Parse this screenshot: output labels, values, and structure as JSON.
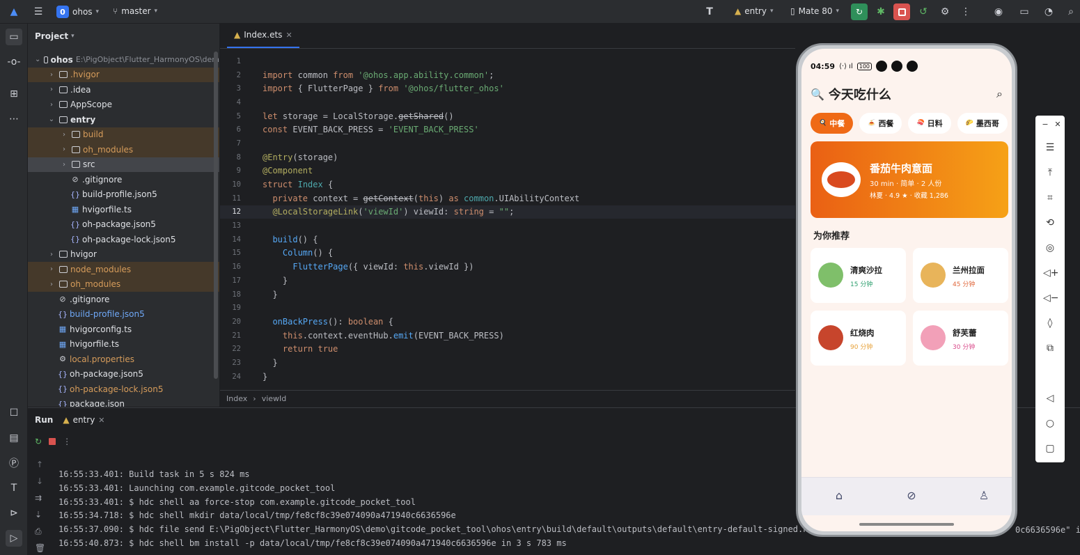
{
  "topbar": {
    "project_badge": "0",
    "project_name": "ohos",
    "branch": "master",
    "run_config": "entry",
    "device": "Mate 80"
  },
  "project_panel": {
    "title": "Project",
    "root_name": "ohos",
    "root_path": "E:\\PigObject\\Flutter_HarmonyOS\\dem",
    "items": [
      {
        "label": ".hvigor",
        "type": "folder",
        "depth": 1,
        "expand": "closed",
        "style": "excluded"
      },
      {
        "label": ".idea",
        "type": "folder",
        "depth": 1,
        "expand": "closed",
        "style": "normal"
      },
      {
        "label": "AppScope",
        "type": "folder",
        "depth": 1,
        "expand": "closed",
        "style": "normal"
      },
      {
        "label": "entry",
        "type": "module",
        "depth": 1,
        "expand": "open",
        "style": "bold"
      },
      {
        "label": "build",
        "type": "folder",
        "depth": 2,
        "expand": "closed",
        "style": "excluded"
      },
      {
        "label": "oh_modules",
        "type": "folder",
        "depth": 2,
        "expand": "closed",
        "style": "excluded"
      },
      {
        "label": "src",
        "type": "folder",
        "depth": 2,
        "expand": "closed",
        "style": "selected"
      },
      {
        "label": ".gitignore",
        "type": "ignore",
        "depth": 2,
        "expand": "none",
        "style": "normal"
      },
      {
        "label": "build-profile.json5",
        "type": "json",
        "depth": 2,
        "expand": "none",
        "style": "normal"
      },
      {
        "label": "hvigorfile.ts",
        "type": "ts",
        "depth": 2,
        "expand": "none",
        "style": "normal"
      },
      {
        "label": "oh-package.json5",
        "type": "json",
        "depth": 2,
        "expand": "none",
        "style": "normal"
      },
      {
        "label": "oh-package-lock.json5",
        "type": "json",
        "depth": 2,
        "expand": "none",
        "style": "normal"
      },
      {
        "label": "hvigor",
        "type": "folder",
        "depth": 1,
        "expand": "closed",
        "style": "normal"
      },
      {
        "label": "node_modules",
        "type": "folder",
        "depth": 1,
        "expand": "closed",
        "style": "excluded"
      },
      {
        "label": "oh_modules",
        "type": "folder",
        "depth": 1,
        "expand": "closed",
        "style": "excluded"
      },
      {
        "label": ".gitignore",
        "type": "ignore",
        "depth": 1,
        "expand": "none",
        "style": "normal"
      },
      {
        "label": "build-profile.json5",
        "type": "json",
        "depth": 1,
        "expand": "none",
        "style": "modified"
      },
      {
        "label": "hvigorconfig.ts",
        "type": "ts",
        "depth": 1,
        "expand": "none",
        "style": "normal"
      },
      {
        "label": "hvigorfile.ts",
        "type": "ts",
        "depth": 1,
        "expand": "none",
        "style": "normal"
      },
      {
        "label": "local.properties",
        "type": "props",
        "depth": 1,
        "expand": "none",
        "style": "orange"
      },
      {
        "label": "oh-package.json5",
        "type": "json",
        "depth": 1,
        "expand": "none",
        "style": "normal"
      },
      {
        "label": "oh-package-lock.json5",
        "type": "json",
        "depth": 1,
        "expand": "none",
        "style": "orange"
      },
      {
        "label": "package.json",
        "type": "json",
        "depth": 1,
        "expand": "none",
        "style": "normal"
      }
    ]
  },
  "editor": {
    "tab_label": "Index.ets",
    "current_line": 12,
    "lines": [
      {
        "n": "1",
        "t": []
      },
      {
        "n": "2",
        "t": [
          [
            "kw",
            "import"
          ],
          [
            "plain",
            " common "
          ],
          [
            "kw",
            "from"
          ],
          [
            "plain",
            " "
          ],
          [
            "str",
            "'@ohos.app.ability.common'"
          ],
          [
            "plain",
            ";"
          ]
        ]
      },
      {
        "n": "3",
        "t": [
          [
            "kw",
            "import"
          ],
          [
            "plain",
            " { FlutterPage } "
          ],
          [
            "kw",
            "from"
          ],
          [
            "plain",
            " "
          ],
          [
            "str",
            "'@ohos/flutter_ohos'"
          ]
        ]
      },
      {
        "n": "4",
        "t": []
      },
      {
        "n": "5",
        "t": [
          [
            "kw",
            "let"
          ],
          [
            "plain",
            " storage = LocalStorage."
          ],
          [
            "strike",
            "getShared"
          ],
          [
            "plain",
            "()"
          ]
        ]
      },
      {
        "n": "6",
        "t": [
          [
            "kw",
            "const"
          ],
          [
            "plain",
            " EVENT_BACK_PRESS = "
          ],
          [
            "str",
            "'EVENT_BACK_PRESS'"
          ]
        ]
      },
      {
        "n": "7",
        "t": []
      },
      {
        "n": "8",
        "t": [
          [
            "ann",
            "@Entry"
          ],
          [
            "plain",
            "(storage)"
          ]
        ]
      },
      {
        "n": "9",
        "t": [
          [
            "ann",
            "@Component"
          ]
        ]
      },
      {
        "n": "10",
        "t": [
          [
            "kw",
            "struct"
          ],
          [
            "plain",
            " "
          ],
          [
            "cls",
            "Index"
          ],
          [
            "plain",
            " {"
          ]
        ]
      },
      {
        "n": "11",
        "t": [
          [
            "kw",
            "  private"
          ],
          [
            "plain",
            " context = "
          ],
          [
            "strike",
            "getContext"
          ],
          [
            "plain",
            "("
          ],
          [
            "kw",
            "this"
          ],
          [
            "plain",
            ") "
          ],
          [
            "kw",
            "as"
          ],
          [
            "plain",
            " "
          ],
          [
            "cls",
            "common"
          ],
          [
            "plain",
            ".UIAbilityContext"
          ]
        ]
      },
      {
        "n": "12",
        "t": [
          [
            "ann",
            "  @LocalStorageLink"
          ],
          [
            "plain",
            "("
          ],
          [
            "str",
            "'viewId'"
          ],
          [
            "plain",
            ") viewId: "
          ],
          [
            "kw",
            "string"
          ],
          [
            "plain",
            " = "
          ],
          [
            "str",
            "\"\""
          ],
          [
            "plain",
            ";"
          ]
        ]
      },
      {
        "n": "13",
        "t": []
      },
      {
        "n": "14",
        "t": [
          [
            "fn",
            "  build"
          ],
          [
            "plain",
            "() {"
          ]
        ]
      },
      {
        "n": "15",
        "t": [
          [
            "fn",
            "    Column"
          ],
          [
            "plain",
            "() {"
          ]
        ]
      },
      {
        "n": "16",
        "t": [
          [
            "fn",
            "      FlutterPage"
          ],
          [
            "plain",
            "({ viewId: "
          ],
          [
            "kw",
            "this"
          ],
          [
            "plain",
            ".viewId })"
          ]
        ]
      },
      {
        "n": "17",
        "t": [
          [
            "plain",
            "    }"
          ]
        ]
      },
      {
        "n": "18",
        "t": [
          [
            "plain",
            "  }"
          ]
        ]
      },
      {
        "n": "19",
        "t": []
      },
      {
        "n": "20",
        "t": [
          [
            "fn",
            "  onBackPress"
          ],
          [
            "plain",
            "(): "
          ],
          [
            "kw",
            "boolean"
          ],
          [
            "plain",
            " {"
          ]
        ]
      },
      {
        "n": "21",
        "t": [
          [
            "kw",
            "    this"
          ],
          [
            "plain",
            ".context.eventHub."
          ],
          [
            "fn",
            "emit"
          ],
          [
            "plain",
            "(EVENT_BACK_PRESS)"
          ]
        ]
      },
      {
        "n": "22",
        "t": [
          [
            "kw",
            "    return"
          ],
          [
            "plain",
            " "
          ],
          [
            "kw",
            "true"
          ]
        ]
      },
      {
        "n": "23",
        "t": [
          [
            "plain",
            "  }"
          ]
        ]
      },
      {
        "n": "24",
        "t": [
          [
            "plain",
            "}"
          ]
        ]
      }
    ],
    "breadcrumb": [
      "Index",
      "viewId"
    ]
  },
  "run_panel": {
    "title": "Run",
    "tab_label": "entry",
    "log": [
      "16:55:33.401: Build task in 5 s 824 ms",
      "16:55:33.401: Launching com.example.gitcode_pocket_tool",
      "16:55:33.401: $ hdc shell aa force-stop com.example.gitcode_pocket_tool",
      "16:55:34.718: $ hdc shell mkdir data/local/tmp/fe8cf8c39e074090a471940c6636596e",
      "16:55:37.090: $ hdc file send E:\\PigObject\\Flutter_HarmonyOS\\demo\\gitcode_pocket_tool\\ohos\\entry\\build\\default\\outputs\\default\\entry-default-signed.ha",
      "16:55:40.873: $ hdc shell bm install -p data/local/tmp/fe8cf8c39e074090a471940c6636596e in 3 s 783 ms"
    ],
    "log_overflow_right": "0c6636596e\" in"
  },
  "phone": {
    "time": "04:59",
    "battery": "100",
    "app_title": "今天吃什么",
    "chips": [
      {
        "emoji": "🍳",
        "label": "中餐",
        "active": true
      },
      {
        "emoji": "🍝",
        "label": "西餐",
        "active": false
      },
      {
        "emoji": "🍣",
        "label": "日料",
        "active": false
      },
      {
        "emoji": "🌮",
        "label": "墨西哥",
        "active": false
      }
    ],
    "featured": {
      "title": "番茄牛肉意面",
      "meta": "30 min · 简单 · 2 人份",
      "rating_line": "林夏 · 4.9 ★ · 收藏 1,286"
    },
    "section_title": "为你推荐",
    "cards": [
      {
        "name": "清爽沙拉",
        "time": "15 分钟",
        "time_color": "#2e9f6e",
        "icon_color": "#7fbf6a"
      },
      {
        "name": "兰州拉面",
        "time": "45 分钟",
        "time_color": "#e0683c",
        "icon_color": "#e8b45a"
      },
      {
        "name": "红烧肉",
        "time": "90 分钟",
        "time_color": "#e7a23a",
        "icon_color": "#c7452c"
      },
      {
        "name": "舒芙蕾",
        "time": "30 分钟",
        "time_color": "#d94a8a",
        "icon_color": "#f2a0b8"
      }
    ]
  }
}
